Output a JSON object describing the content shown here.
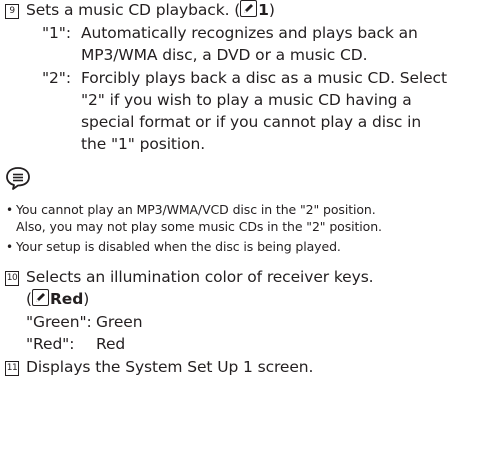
{
  "item9": {
    "number": "9",
    "text_before": "Sets a music CD playback. (",
    "default_value": "1",
    "text_after": ")",
    "options": [
      {
        "key": "\"1\":",
        "lines": [
          "Automatically recognizes and plays back an",
          "MP3/WMA disc, a DVD or a music CD."
        ]
      },
      {
        "key": "\"2\":",
        "lines": [
          "Forcibly plays back a disc as a music CD.  Select",
          "\"2\" if you wish to play a music CD having a",
          "special format or if you cannot play a disc in",
          "the \"1\" position."
        ]
      }
    ]
  },
  "notes": {
    "icon": "note-icon",
    "items": [
      [
        "You cannot play an MP3/WMA/VCD disc in the \"2\" position.",
        "Also, you may not play some music CDs in the \"2\" position."
      ],
      [
        "Your setup is disabled when the disc is being played."
      ]
    ]
  },
  "item10": {
    "number": "10",
    "line1": "Selects an illumination color of receiver keys.",
    "default_open": "(",
    "default_value": "Red",
    "default_close": ")",
    "options": [
      {
        "key": "\"Green\":",
        "value": "Green"
      },
      {
        "key": "\"Red\":",
        "value": "Red"
      }
    ]
  },
  "item11": {
    "number": "11",
    "text": "Displays the System Set Up 1 screen."
  }
}
